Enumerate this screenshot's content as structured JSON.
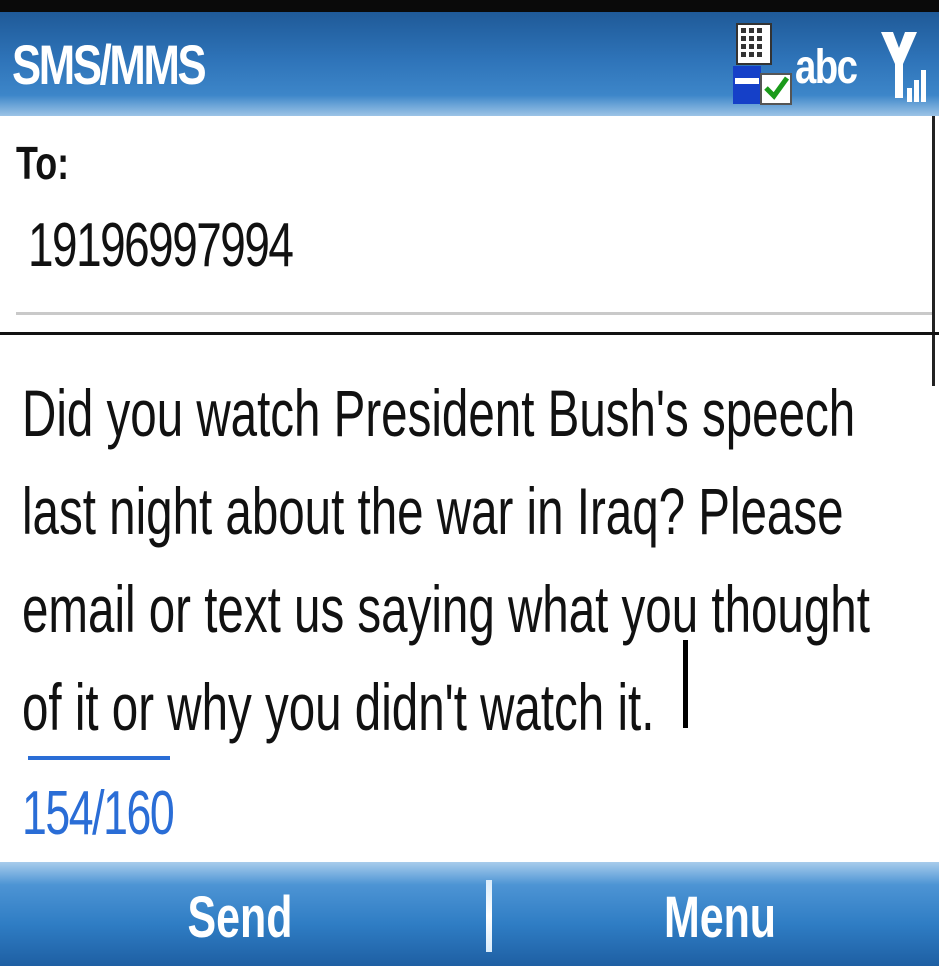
{
  "app": {
    "title": "SMS/MMS"
  },
  "status": {
    "input_mode": "abc",
    "icons": [
      "keyboard-connected-icon",
      "signal-strength-icon"
    ]
  },
  "recipient": {
    "label": "To:",
    "value": "19196997994"
  },
  "message": {
    "lines": [
      "Did you watch President Bush's speech",
      "last night about the war in Iraq?  Please",
      "email or text us saying what you thought",
      "of it or why you didn't watch it."
    ],
    "char_count": "154/160"
  },
  "softkeys": {
    "left": "Send",
    "right": "Menu"
  },
  "colors": {
    "accent": "#2e73b8",
    "counter": "#2a6dd6"
  }
}
